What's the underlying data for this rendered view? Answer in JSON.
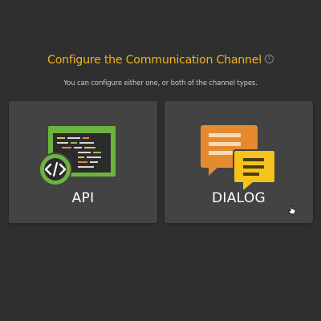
{
  "header": {
    "title": "Configure the Communication Channel",
    "help_icon": "question-circle-icon",
    "subtitle": "You can configure either one, or both of the channel types."
  },
  "channels": [
    {
      "label": "API",
      "icon": "code-window-icon"
    },
    {
      "label": "DIALOG",
      "icon": "chat-bubbles-icon"
    }
  ],
  "colors": {
    "background": "#2f2f2f",
    "card": "#434343",
    "title": "#f1b11c",
    "api_green": "#6db33f",
    "dialog_orange": "#e58a2e",
    "dialog_yellow": "#f6c21c"
  }
}
